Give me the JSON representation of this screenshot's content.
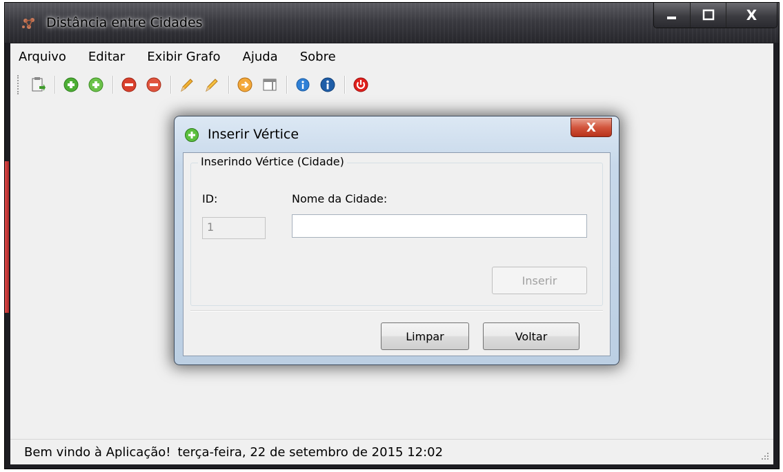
{
  "window": {
    "title": "Distância entre Cidades",
    "buttons": {
      "minimize": "▬",
      "maximize": "☐",
      "close": "X"
    }
  },
  "menu": [
    "Arquivo",
    "Editar",
    "Exibir Grafo",
    "Ajuda",
    "Sobre"
  ],
  "toolbar": [
    {
      "name": "new-document-icon",
      "color": "#6aa84f"
    },
    {
      "name": "add-green-icon",
      "color": "#3f9b2b"
    },
    {
      "name": "add-green-icon-2",
      "color": "#3f9b2b"
    },
    {
      "name": "remove-red-icon",
      "color": "#d23a2a"
    },
    {
      "name": "remove-red-icon-2",
      "color": "#d23a2a"
    },
    {
      "name": "pencil-icon",
      "color": "#e8a020"
    },
    {
      "name": "pencil-icon-2",
      "color": "#e8a020"
    },
    {
      "name": "orange-arrow-icon",
      "color": "#f0a030"
    },
    {
      "name": "window-icon",
      "color": "#707070"
    },
    {
      "name": "info-icon",
      "color": "#1e6fc8"
    },
    {
      "name": "info-icon-2",
      "color": "#1e5aa8"
    },
    {
      "name": "power-icon",
      "color": "#e02020"
    }
  ],
  "dialog": {
    "title": "Inserir Vértice",
    "close": "X",
    "group_title": "Inserindo Vértice (Cidade)",
    "id_label": "ID:",
    "id_value": "1",
    "name_label": "Nome da Cidade:",
    "name_value": "",
    "insert_label": "Inserir",
    "clear_label": "Limpar",
    "back_label": "Voltar"
  },
  "status": {
    "message": "Bem vindo à Aplicação!",
    "date": "terça-feira, 22 de setembro de 2015  12:02"
  }
}
